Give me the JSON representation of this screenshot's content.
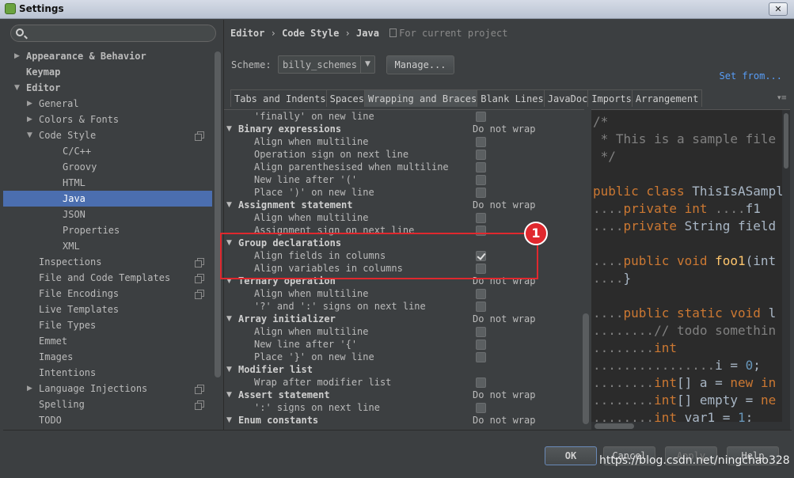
{
  "window": {
    "title": "Settings",
    "close_glyph": "✕",
    "app_icon": "intellij-icon"
  },
  "search": {
    "placeholder": ""
  },
  "tree": [
    {
      "label": "Appearance & Behavior",
      "level": 0,
      "arrow": "▶",
      "bold": true
    },
    {
      "label": "Keymap",
      "level": 0,
      "arrow": "",
      "bold": true
    },
    {
      "label": "Editor",
      "level": 0,
      "arrow": "▼",
      "bold": true
    },
    {
      "label": "General",
      "level": 1,
      "arrow": "▶"
    },
    {
      "label": "Colors & Fonts",
      "level": 1,
      "arrow": "▶"
    },
    {
      "label": "Code Style",
      "level": 1,
      "arrow": "▼",
      "copy": true
    },
    {
      "label": "C/C++",
      "level": 2
    },
    {
      "label": "Groovy",
      "level": 2
    },
    {
      "label": "HTML",
      "level": 2
    },
    {
      "label": "Java",
      "level": 2,
      "selected": true
    },
    {
      "label": "JSON",
      "level": 2
    },
    {
      "label": "Properties",
      "level": 2
    },
    {
      "label": "XML",
      "level": 2
    },
    {
      "label": "Inspections",
      "level": 1,
      "copy": true
    },
    {
      "label": "File and Code Templates",
      "level": 1,
      "copy": true
    },
    {
      "label": "File Encodings",
      "level": 1,
      "copy": true
    },
    {
      "label": "Live Templates",
      "level": 1
    },
    {
      "label": "File Types",
      "level": 1
    },
    {
      "label": "Emmet",
      "level": 1
    },
    {
      "label": "Images",
      "level": 1
    },
    {
      "label": "Intentions",
      "level": 1
    },
    {
      "label": "Language Injections",
      "level": 1,
      "arrow": "▶",
      "copy": true
    },
    {
      "label": "Spelling",
      "level": 1,
      "copy": true
    },
    {
      "label": "TODO",
      "level": 1
    }
  ],
  "breadcrumb": {
    "part1": "Editor",
    "sep": "›",
    "part2": "Code Style",
    "part3": "Java",
    "hint": "For current project"
  },
  "scheme": {
    "label": "Scheme:",
    "value": "billy_schemes",
    "dropdown_glyph": "▼",
    "manage_label": "Manage..."
  },
  "set_from": "Set from...",
  "tabs": [
    "Tabs and Indents",
    "Spaces",
    "Wrapping and Braces",
    "Blank Lines",
    "JavaDoc",
    "Imports",
    "Arrangement"
  ],
  "active_tab": "Wrapping and Braces",
  "tab_more": "▾≡",
  "options": [
    {
      "label": "'finally' on new line",
      "type": "check",
      "checked": false
    },
    {
      "label": "Binary expressions",
      "type": "group",
      "value": "Do not wrap"
    },
    {
      "label": "Align when multiline",
      "type": "check",
      "checked": false
    },
    {
      "label": "Operation sign on next line",
      "type": "check",
      "checked": false
    },
    {
      "label": "Align parenthesised when multiline",
      "type": "check",
      "checked": false
    },
    {
      "label": "New line after '('",
      "type": "check",
      "checked": false
    },
    {
      "label": "Place ')' on new line",
      "type": "check",
      "checked": false
    },
    {
      "label": "Assignment statement",
      "type": "group",
      "value": "Do not wrap"
    },
    {
      "label": "Align when multiline",
      "type": "check",
      "checked": false
    },
    {
      "label": "Assignment sign on next line",
      "type": "check",
      "checked": false
    },
    {
      "label": "Group declarations",
      "type": "group",
      "value": ""
    },
    {
      "label": "Align fields in columns",
      "type": "check",
      "checked": true
    },
    {
      "label": "Align variables in columns",
      "type": "check",
      "checked": false
    },
    {
      "label": "Ternary operation",
      "type": "group",
      "value": "Do not wrap"
    },
    {
      "label": "Align when multiline",
      "type": "check",
      "checked": false
    },
    {
      "label": "'?' and ':' signs on next line",
      "type": "check",
      "checked": false
    },
    {
      "label": "Array initializer",
      "type": "group",
      "value": "Do not wrap"
    },
    {
      "label": "Align when multiline",
      "type": "check",
      "checked": false
    },
    {
      "label": "New line after '{'",
      "type": "check",
      "checked": false
    },
    {
      "label": "Place '}' on new line",
      "type": "check",
      "checked": false
    },
    {
      "label": "Modifier list",
      "type": "group",
      "value": ""
    },
    {
      "label": "Wrap after modifier list",
      "type": "check",
      "checked": false
    },
    {
      "label": "Assert statement",
      "type": "group",
      "value": "Do not wrap"
    },
    {
      "label": "':' signs on next line",
      "type": "check",
      "checked": false
    },
    {
      "label": "Enum constants",
      "type": "group",
      "value": "Do not wrap"
    }
  ],
  "preview_lines": [
    [
      [
        "cm",
        "/*"
      ]
    ],
    [
      [
        "cm",
        " * This is a sample file"
      ]
    ],
    [
      [
        "cm",
        " */"
      ]
    ],
    [],
    [
      [
        "kw",
        "public class "
      ],
      [
        "",
        "ThisIsASample"
      ]
    ],
    [
      [
        "cm",
        "...."
      ],
      [
        "kw",
        "private int "
      ],
      [
        "cm",
        "...."
      ],
      [
        "",
        "f1"
      ]
    ],
    [
      [
        "cm",
        "...."
      ],
      [
        "kw",
        "private "
      ],
      [
        "",
        "String field"
      ]
    ],
    [],
    [
      [
        "cm",
        "...."
      ],
      [
        "kw",
        "public void "
      ],
      [
        "fn",
        "foo1"
      ],
      [
        "",
        "(int"
      ]
    ],
    [
      [
        "cm",
        "...."
      ],
      [
        "",
        "}"
      ]
    ],
    [],
    [
      [
        "cm",
        "...."
      ],
      [
        "kw",
        "public static void "
      ],
      [
        "",
        "l"
      ]
    ],
    [
      [
        "cm",
        "........"
      ],
      [
        "cm",
        "// todo somethin"
      ]
    ],
    [
      [
        "cm",
        "........"
      ],
      [
        "kw",
        "int"
      ]
    ],
    [
      [
        "cm",
        "................"
      ],
      [
        "",
        "i = "
      ],
      [
        "num",
        "0"
      ],
      [
        "",
        ";"
      ]
    ],
    [
      [
        "cm",
        "........"
      ],
      [
        "kw",
        "int"
      ],
      [
        "",
        "[] a = "
      ],
      [
        "kw",
        "new in"
      ]
    ],
    [
      [
        "cm",
        "........"
      ],
      [
        "kw",
        "int"
      ],
      [
        "",
        "[] empty = "
      ],
      [
        "kw",
        "ne"
      ]
    ],
    [
      [
        "cm",
        "........"
      ],
      [
        "kw",
        "int "
      ],
      [
        "",
        "var1 = "
      ],
      [
        "num",
        "1"
      ],
      [
        "",
        ";"
      ]
    ]
  ],
  "annotation": {
    "badge": "1"
  },
  "footer": {
    "ok_label": "OK",
    "cancel_label": "Cancel",
    "apply_label": "Apply",
    "help_label": "Help"
  },
  "watermark": "https://blog.csdn.net/ningchao328"
}
